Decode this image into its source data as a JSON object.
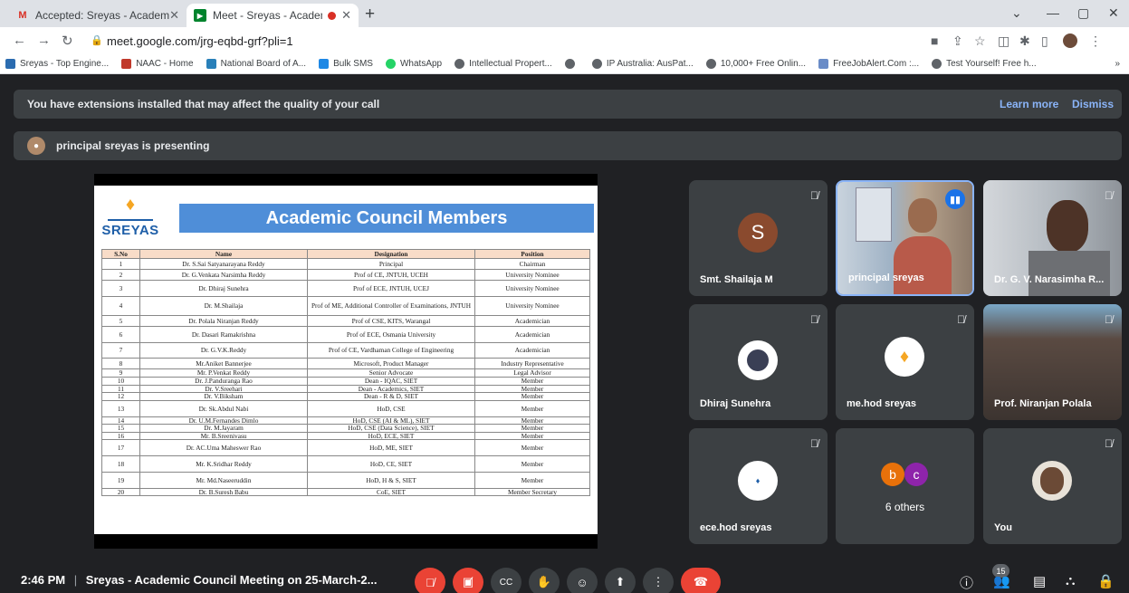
{
  "browser": {
    "tabs": [
      {
        "label": "Accepted: Sreyas - Academic Co",
        "favicon": "gmail-icon"
      },
      {
        "label": "Meet - Sreyas - Academic C",
        "favicon": "meet-icon"
      }
    ],
    "url": "meet.google.com/jrg-eqbd-grf?pli=1",
    "bookmarks": [
      {
        "label": "Sreyas - Top Engine...",
        "color": "#2b6cb0"
      },
      {
        "label": "NAAC - Home",
        "color": "#c0392b"
      },
      {
        "label": "National Board of A...",
        "color": "#2980b9"
      },
      {
        "label": "Bulk SMS",
        "color": "#1e88e5"
      },
      {
        "label": "WhatsApp",
        "color": "#25d366"
      },
      {
        "label": "Intellectual Propert...",
        "color": "#5f6368"
      },
      {
        "label": "",
        "color": "#5f6368"
      },
      {
        "label": "IP Australia: AusPat...",
        "color": "#5f6368"
      },
      {
        "label": "10,000+ Free Onlin...",
        "color": "#5f6368"
      },
      {
        "label": "FreeJobAlert.Com :...",
        "color": "#6a8cc7"
      },
      {
        "label": "Test Yourself! Free h...",
        "color": "#5f6368"
      }
    ]
  },
  "meet": {
    "extension_banner": {
      "text": "You have extensions installed that may affect the quality of your call",
      "learn_more": "Learn more",
      "dismiss": "Dismiss"
    },
    "presenting_banner": "principal sreyas is presenting",
    "slide": {
      "logo_text": "SREYAS",
      "title": "Academic Council Members",
      "headers": [
        "S.No",
        "Name",
        "Designation",
        "Position"
      ],
      "rows": [
        [
          "1",
          "Dr. S.Sai Satyanarayana Reddy",
          "Principal",
          "Chairman"
        ],
        [
          "2",
          "Dr. G.Venkata Narsimha Reddy",
          "Prof of CE, JNTUH, UCEH",
          "University Nominee"
        ],
        [
          "3",
          "Dr. Dhiraj Sunehra",
          "Prof of ECE, JNTUH, UCEJ",
          "University Nominee"
        ],
        [
          "4",
          "Dr. M.Shailaja",
          "Prof of ME, Additional Controller of Examinations, JNTUH",
          "University Nominee"
        ],
        [
          "5",
          "Dr. Polala Niranjan Reddy",
          "Prof of CSE, KITS, Warangal",
          "Academician"
        ],
        [
          "6",
          "Dr. Dasari Ramakrishna",
          "Prof of ECE, Osmania University",
          "Academician"
        ],
        [
          "7",
          "Dr. G.V.K.Reddy",
          "Prof of CE, Vardhaman College of Engineering",
          "Academician"
        ],
        [
          "8",
          "Mr.Aniket Bannerjee",
          "Microsoft, Product Manager",
          "Industry Representative"
        ],
        [
          "9",
          "Mr. P.Venkat Reddy",
          "Senior Advocate",
          "Legal Advisor"
        ],
        [
          "10",
          "Dr. J.Panduranga Rao",
          "Dean - IQAC, SIET",
          "Member"
        ],
        [
          "11",
          "Dr. V.Sreehari",
          "Dean - Academics, SIET",
          "Member"
        ],
        [
          "12",
          "Dr. V.Biksham",
          "Dean - R & D, SIET",
          "Member"
        ],
        [
          "13",
          "Dr. Sk.Abdul Nabi",
          "HoD, CSE",
          "Member"
        ],
        [
          "14",
          "Dr. U.M.Fernandes Dimlo",
          "HoD, CSE (AI & ML), SIET",
          "Member"
        ],
        [
          "15",
          "Dr. M.Jayaram",
          "HoD, CSE (Data Science), SIET",
          "Member"
        ],
        [
          "16",
          "Mr. B.Sreenivasu",
          "HoD, ECE, SIET",
          "Member"
        ],
        [
          "17",
          "Dr. AC.Uma Maheswer Rao",
          "HoD, ME, SIET",
          "Member"
        ],
        [
          "18",
          "Mr. K.Sridhar Reddy",
          "HoD, CE, SIET",
          "Member"
        ],
        [
          "19",
          "Mr. Md.Naseeruddin",
          "HoD, H & S, SIET",
          "Member"
        ],
        [
          "20",
          "Dr. B.Suresh Babu",
          "CoE, SIET",
          "Member Secretary"
        ]
      ]
    },
    "tiles": [
      {
        "name": "Smt. Shailaja M",
        "initial": "S",
        "avatar_color": "#8a4a2e"
      },
      {
        "name": "principal sreyas"
      },
      {
        "name": "Dr. G. V. Narasimha R..."
      },
      {
        "name": "Dhiraj Sunehra"
      },
      {
        "name": "me.hod sreyas"
      },
      {
        "name": "Prof. Niranjan Polala"
      },
      {
        "name": "ece.hod sreyas"
      },
      {
        "name": "6 others",
        "initials": [
          "b",
          "c"
        ]
      },
      {
        "name": "You"
      }
    ],
    "bottom": {
      "time": "2:46 PM",
      "meeting_title": "Sreyas - Academic Council Meeting on 25-March-2...",
      "participants_count": "15"
    }
  }
}
